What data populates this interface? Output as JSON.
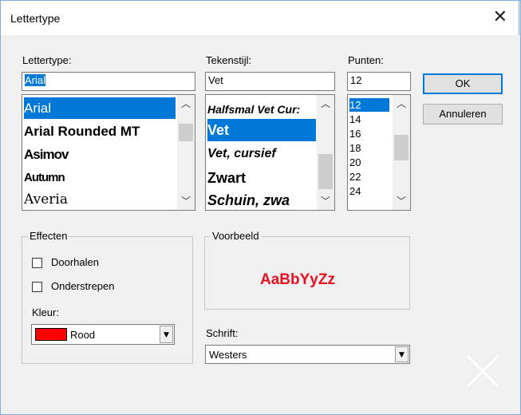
{
  "window": {
    "title": "Lettertype",
    "close_glyph": "✕"
  },
  "font": {
    "label": "Lettertype:",
    "value": "Arial",
    "items": [
      "Arial",
      "Arial Rounded MT",
      "Asimov",
      "Autumn",
      "Averia"
    ]
  },
  "style": {
    "label": "Tekenstijl:",
    "value": "Vet",
    "items": [
      "Halfsmal Vet Cur:",
      "Vet",
      "Vet, cursief",
      "Zwart",
      "Schuin, zwa"
    ]
  },
  "size": {
    "label": "Punten:",
    "value": "12",
    "items": [
      "12",
      "14",
      "16",
      "18",
      "20",
      "22",
      "24"
    ]
  },
  "buttons": {
    "ok": "OK",
    "cancel": "Annuleren"
  },
  "effects": {
    "label": "Effecten",
    "strikeout": "Doorhalen",
    "underline": "Onderstrepen",
    "color_label": "Kleur:",
    "color_value": "Rood",
    "color_hex": "#ff0000"
  },
  "preview": {
    "label": "Voorbeeld",
    "sample": "AaBbYyZz",
    "sample_color": "#e81123"
  },
  "script": {
    "label": "Schrift:",
    "value": "Westers"
  },
  "icons": {
    "up": "up-arrow-icon",
    "down": "down-arrow-icon",
    "dropdown": "dropdown-arrow-icon",
    "close": "close-icon"
  }
}
